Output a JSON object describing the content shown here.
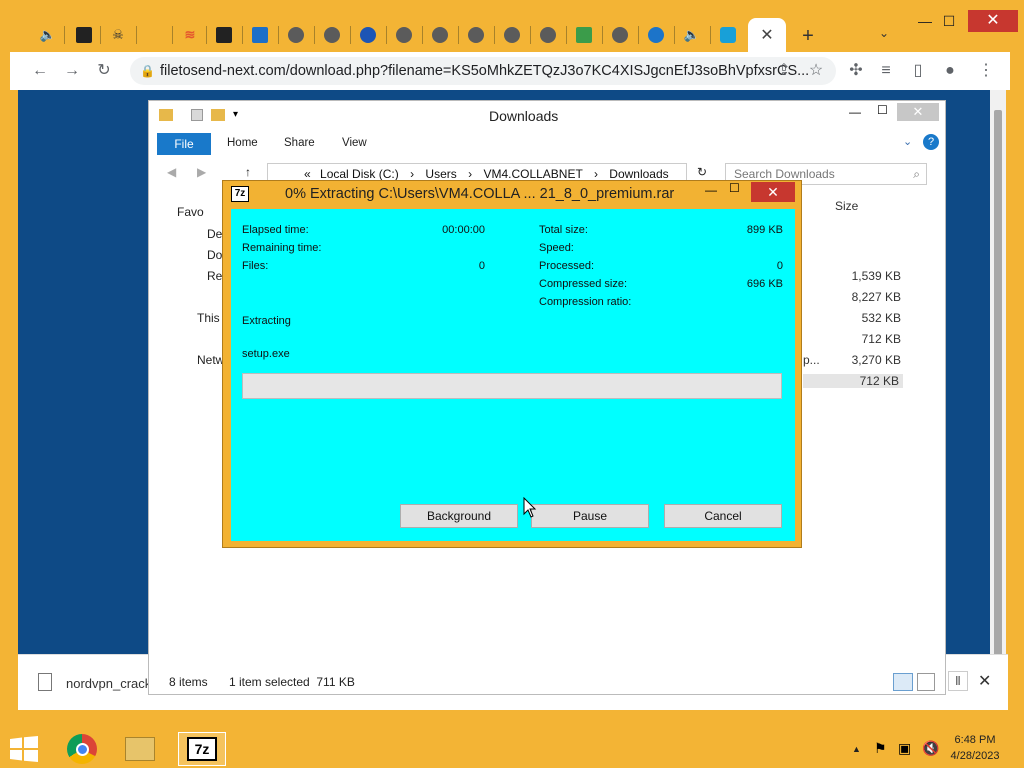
{
  "browser": {
    "url": "filetosend-next.com/download.php?filename=KS5oMhkZETQzJ3o7KC4XISJgcnEfJ3soBhVpfxsrCS...",
    "active_tab_close": "✕",
    "new_tab": "+",
    "tab_search": "⌄",
    "window_minimize": "—",
    "window_maximize": "☐",
    "window_close": "✕",
    "nav": {
      "back": "←",
      "forward": "→",
      "reload": "↻"
    },
    "download_item": "nordvpn_crack",
    "download_close": "✕",
    "accent": "#f3b435"
  },
  "explorer": {
    "title": "Downloads",
    "ribbon": {
      "file": "File",
      "tabs": [
        "Home",
        "Share",
        "View"
      ]
    },
    "address": {
      "prefix": "«",
      "parts": [
        "Local Disk (C:)",
        "Users",
        "VM4.COLLABNET",
        "Downloads"
      ]
    },
    "search_placeholder": "Search Downloads",
    "column_size": "Size",
    "nav_items": [
      "Favo",
      "De",
      "Do",
      "Re",
      "This",
      "Netw"
    ],
    "partial_name": "p...",
    "sizes": [
      "1,539 KB",
      "8,227 KB",
      "532 KB",
      "712 KB",
      "3,270 KB",
      "712 KB"
    ],
    "status": {
      "items": "8 items",
      "selected": "1 item selected  711 KB"
    }
  },
  "sevenzip": {
    "logo": "7z",
    "title": "0% Extracting C:\\Users\\VM4.COLLA ... 21_8_0_premium.rar",
    "left": {
      "elapsed_label": "Elapsed time:",
      "elapsed_value": "00:00:00",
      "remaining_label": "Remaining time:",
      "remaining_value": "",
      "files_label": "Files:",
      "files_value": "0"
    },
    "right": {
      "total_label": "Total size:",
      "total_value": "899 KB",
      "speed_label": "Speed:",
      "speed_value": "",
      "processed_label": "Processed:",
      "processed_value": "0",
      "compressed_label": "Compressed size:",
      "compressed_value": "696 KB",
      "ratio_label": "Compression ratio:",
      "ratio_value": ""
    },
    "status": "Extracting",
    "current_file": "setup.exe",
    "progress": 0,
    "buttons": {
      "background": "Background",
      "pause": "Pause",
      "cancel": "Cancel"
    }
  },
  "taskbar": {
    "time": "6:48 PM",
    "date": "4/28/2023",
    "chevron": "▲",
    "seven_zip_label": "7z"
  }
}
